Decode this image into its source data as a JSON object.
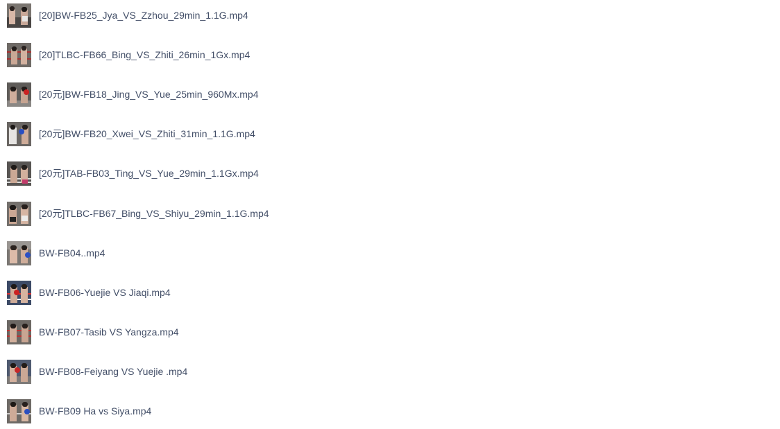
{
  "files": [
    {
      "name": "[20]BW-FB25_Jya_VS_Zzhou_29min_1.1G.mp4",
      "thumbnail": "video-thumbnail"
    },
    {
      "name": "[20]TLBC-FB66_Bing_VS_Zhiti_26min_1Gx.mp4",
      "thumbnail": "video-thumbnail"
    },
    {
      "name": "[20元]BW-FB18_Jing_VS_Yue_25min_960Mx.mp4",
      "thumbnail": "video-thumbnail"
    },
    {
      "name": "[20元]BW-FB20_Xwei_VS_Zhiti_31min_1.1G.mp4",
      "thumbnail": "video-thumbnail"
    },
    {
      "name": "[20元]TAB-FB03_Ting_VS_Yue_29min_1.1Gx.mp4",
      "thumbnail": "video-thumbnail"
    },
    {
      "name": "[20元]TLBC-FB67_Bing_VS_Shiyu_29min_1.1G.mp4",
      "thumbnail": "video-thumbnail"
    },
    {
      "name": "BW-FB04..mp4",
      "thumbnail": "video-thumbnail"
    },
    {
      "name": "BW-FB06-Yuejie VS Jiaqi.mp4",
      "thumbnail": "video-thumbnail"
    },
    {
      "name": "BW-FB07-Tasib VS Yangza.mp4",
      "thumbnail": "video-thumbnail"
    },
    {
      "name": "BW-FB08-Feiyang VS Yuejie .mp4",
      "thumbnail": "video-thumbnail"
    },
    {
      "name": "BW-FB09 Ha vs Siya.mp4",
      "thumbnail": "video-thumbnail"
    }
  ],
  "colors": {
    "file_name_text": "#424e67",
    "background": "#ffffff"
  }
}
